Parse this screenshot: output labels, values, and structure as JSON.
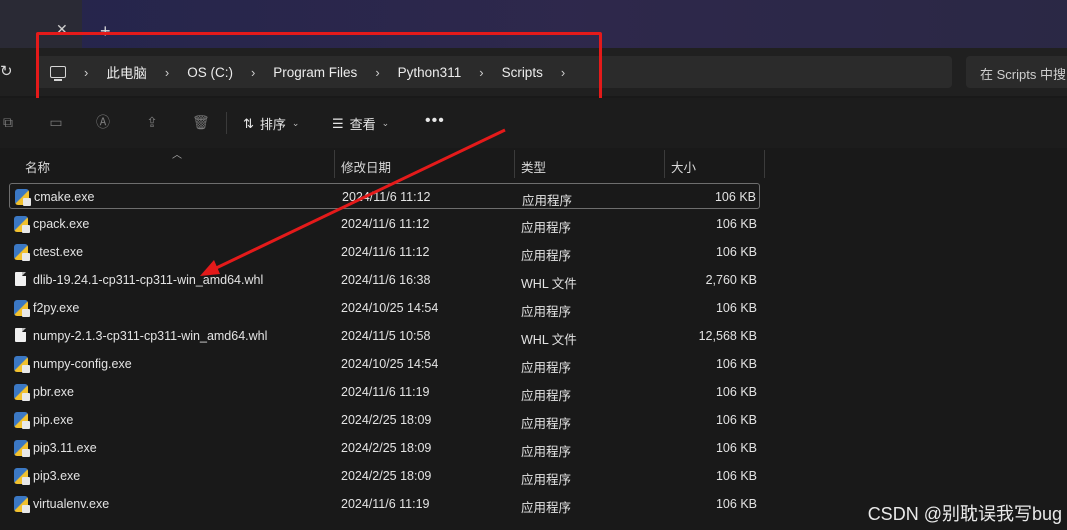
{
  "tab": {
    "close_glyph": "✕",
    "new_tab_glyph": "+"
  },
  "toolbar_icons": [
    "copy-icon",
    "paste-icon",
    "rename-icon",
    "share-icon",
    "delete-icon"
  ],
  "breadcrumb": [
    "此电脑",
    "OS (C:)",
    "Program Files",
    "Python311",
    "Scripts"
  ],
  "breadcrumb_sep": "›",
  "search": {
    "text": "在 Scripts 中搜"
  },
  "toolbar": {
    "sort_label": "排序",
    "view_label": "查看",
    "more_label": "•••"
  },
  "columns": {
    "name": "名称",
    "date": "修改日期",
    "type": "类型",
    "size": "大小"
  },
  "files": [
    {
      "name": "cmake.exe",
      "date": "2024/11/6 11:12",
      "type": "应用程序",
      "size": "106 KB",
      "kind": "exe"
    },
    {
      "name": "cpack.exe",
      "date": "2024/11/6 11:12",
      "type": "应用程序",
      "size": "106 KB",
      "kind": "exe"
    },
    {
      "name": "ctest.exe",
      "date": "2024/11/6 11:12",
      "type": "应用程序",
      "size": "106 KB",
      "kind": "exe"
    },
    {
      "name": "dlib-19.24.1-cp311-cp311-win_amd64.whl",
      "date": "2024/11/6 16:38",
      "type": "WHL 文件",
      "size": "2,760 KB",
      "kind": "file"
    },
    {
      "name": "f2py.exe",
      "date": "2024/10/25 14:54",
      "type": "应用程序",
      "size": "106 KB",
      "kind": "exe"
    },
    {
      "name": "numpy-2.1.3-cp311-cp311-win_amd64.whl",
      "date": "2024/11/5 10:58",
      "type": "WHL 文件",
      "size": "12,568 KB",
      "kind": "file"
    },
    {
      "name": "numpy-config.exe",
      "date": "2024/10/25 14:54",
      "type": "应用程序",
      "size": "106 KB",
      "kind": "exe"
    },
    {
      "name": "pbr.exe",
      "date": "2024/11/6 11:19",
      "type": "应用程序",
      "size": "106 KB",
      "kind": "exe"
    },
    {
      "name": "pip.exe",
      "date": "2024/2/25 18:09",
      "type": "应用程序",
      "size": "106 KB",
      "kind": "exe"
    },
    {
      "name": "pip3.11.exe",
      "date": "2024/2/25 18:09",
      "type": "应用程序",
      "size": "106 KB",
      "kind": "exe"
    },
    {
      "name": "pip3.exe",
      "date": "2024/2/25 18:09",
      "type": "应用程序",
      "size": "106 KB",
      "kind": "exe"
    },
    {
      "name": "virtualenv.exe",
      "date": "2024/11/6 11:19",
      "type": "应用程序",
      "size": "106 KB",
      "kind": "exe"
    }
  ],
  "watermark": "CSDN @别耽误我写bug",
  "annotation_color": "#e41a1a"
}
